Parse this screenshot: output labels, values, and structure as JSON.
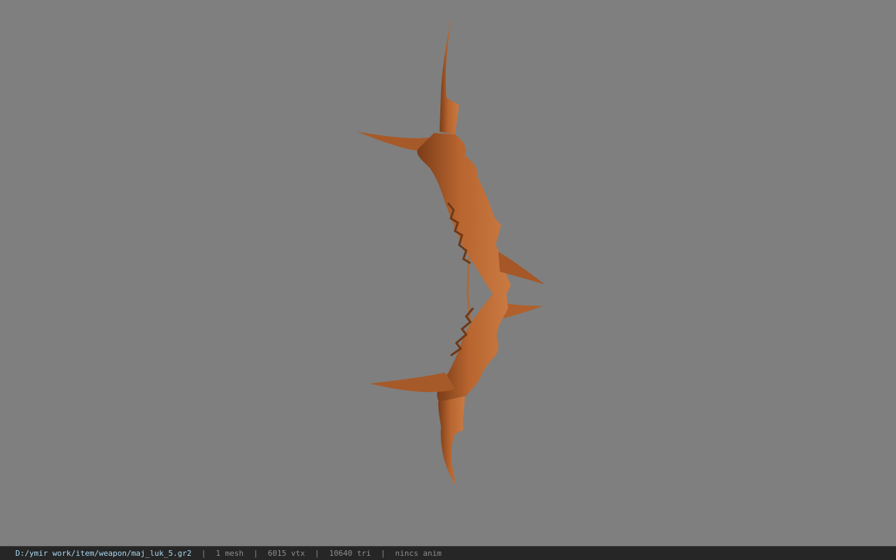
{
  "viewport": {
    "background_color": "#7f7f7f",
    "model_color": "#b0602c",
    "model_shadow_color": "#6e3816"
  },
  "statusbar": {
    "file_path": "D:/ymir work/item/weapon/maj_luk_5.gr2",
    "separator": "|",
    "mesh_count": "1 mesh",
    "vertex_count": "6015 vtx",
    "triangle_count": "10640 tri",
    "animation": "nincs anim"
  }
}
